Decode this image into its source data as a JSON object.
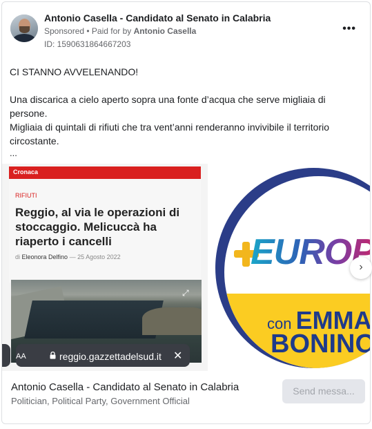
{
  "post": {
    "author": "Antonio Casella - Candidato al Senato in Calabria",
    "sponsored": "Sponsored",
    "separator": " • ",
    "paid_for_prefix": "Paid for by ",
    "paid_for_by": "Antonio Casella",
    "ad_id": "ID: 1590631864667203",
    "more_icon": "more-options-icon",
    "text_lines": [
      "CI STANNO AVVELENANDO!",
      "Una discarica a cielo aperto sopra una fonte d’acqua che serve migliaia di persone.",
      "Migliaia di quintali di rifiuti che tra vent’anni renderanno invivibile il territorio circostante.",
      "..."
    ]
  },
  "carousel": {
    "card1": {
      "section": "Cronaca",
      "category": "RIFIUTI",
      "headline": "Reggio, al via le operazioni di stoccaggio. Melicuccà ha riaperto i cancelli",
      "by_prefix": "di ",
      "author": "Eleonora Delfino",
      "date_sep": " — ",
      "date": "25 Agosto 2022",
      "url_aa": "AA",
      "url": "reggio.gazzettadelsud.it",
      "url_close": "✕",
      "expand_icon": "⤢"
    },
    "card2": {
      "euro_text": "EUROP",
      "con": "con ",
      "emma": "EMMA",
      "bonino": "BONINO"
    },
    "next_icon": "›"
  },
  "footer": {
    "name": "Antonio Casella - Candidato al Senato in Calabria",
    "categories": "Politician, Political Party, Government Official",
    "button": "Send messa..."
  },
  "colors": {
    "news_red": "#d9201f",
    "europa_yellow": "#fbcc22",
    "europa_blue": "#1e3a8a"
  }
}
